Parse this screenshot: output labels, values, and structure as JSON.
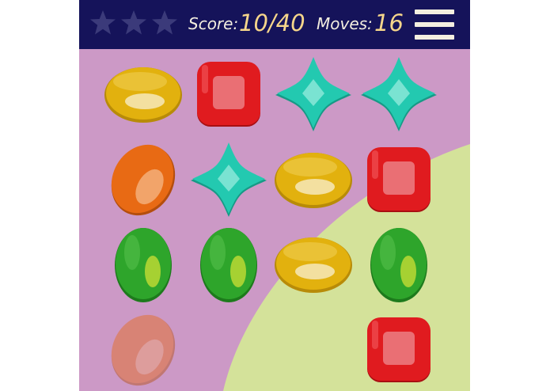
{
  "hud": {
    "stars_total": 3,
    "stars_earned": 0,
    "score_label": "Score:",
    "score_value": "10/40",
    "moves_label": "Moves:",
    "moves_value": "16"
  },
  "board": {
    "rows": 4,
    "cols": 4,
    "cells": [
      [
        "yellow-oval",
        "red-square",
        "teal-star",
        "teal-star"
      ],
      [
        "orange-oval",
        "teal-star",
        "yellow-oval",
        "red-square"
      ],
      [
        "green-oval",
        "green-oval",
        "yellow-oval",
        "green-oval"
      ],
      [
        "orange-oval-faded",
        "empty",
        "empty",
        "red-square"
      ]
    ]
  },
  "colors": {
    "hud_bg": "#15135a",
    "hud_text": "#f4efe0",
    "hud_value": "#f6d68b",
    "star_empty": "#3b3a7a",
    "board_bg": "#cc99c6",
    "blob": "#d4e29a",
    "yellow": "#e2b10e",
    "red": "#e01b1f",
    "teal": "#23c9b0",
    "orange": "#e86a14",
    "green": "#2ea52b"
  }
}
